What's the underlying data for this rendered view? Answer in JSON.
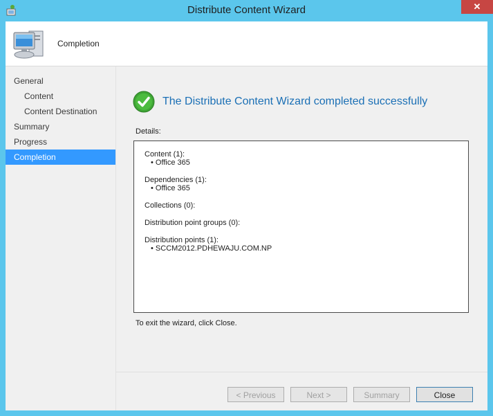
{
  "window": {
    "title": "Distribute Content Wizard",
    "close_glyph": "✕"
  },
  "header": {
    "title": "Completion",
    "icon": "computer-icon"
  },
  "nav": {
    "items": [
      {
        "label": "General",
        "level": 0,
        "active": false
      },
      {
        "label": "Content",
        "level": 1,
        "active": false
      },
      {
        "label": "Content Destination",
        "level": 1,
        "active": false
      },
      {
        "label": "Summary",
        "level": 0,
        "active": false
      },
      {
        "label": "Progress",
        "level": 0,
        "active": false
      },
      {
        "label": "Completion",
        "level": 0,
        "active": true
      }
    ]
  },
  "main": {
    "success_message": "The Distribute Content Wizard completed successfully",
    "details_label": "Details:",
    "details": {
      "content_heading": "Content (1):",
      "content_item": "• Office 365",
      "dependencies_heading": "Dependencies (1):",
      "dependencies_item": "• Office 365",
      "collections_heading": "Collections (0):",
      "dp_groups_heading": "Distribution point groups (0):",
      "dp_heading": "Distribution points (1):",
      "dp_item": "• SCCM2012.PDHEWAJU.COM.NP"
    },
    "exit_text": "To exit the wizard, click Close."
  },
  "buttons": {
    "previous": "< Previous",
    "next": "Next >",
    "summary": "Summary",
    "close": "Close"
  },
  "colors": {
    "frame": "#5bc6ec",
    "accent": "#3399ff",
    "success_text": "#1a6fb5",
    "close_button": "#c74643"
  }
}
